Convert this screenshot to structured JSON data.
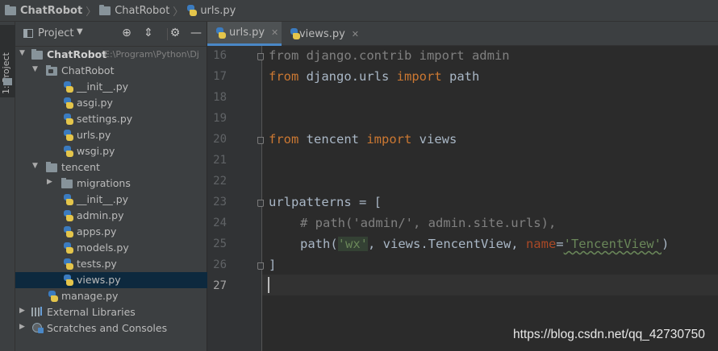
{
  "breadcrumb": {
    "items": [
      "ChatRobot",
      "ChatRobot",
      "urls.py"
    ]
  },
  "left_strip": {
    "label": "1: Project"
  },
  "project_panel": {
    "title": "Project",
    "tree": [
      {
        "label": "ChatRobot",
        "path": "E:\\Program\\Python\\Dj",
        "type": "project"
      },
      {
        "label": "ChatRobot",
        "type": "module"
      },
      {
        "label": "__init__.py",
        "type": "py"
      },
      {
        "label": "asgi.py",
        "type": "py"
      },
      {
        "label": "settings.py",
        "type": "py"
      },
      {
        "label": "urls.py",
        "type": "py"
      },
      {
        "label": "wsgi.py",
        "type": "py"
      },
      {
        "label": "tencent",
        "type": "folder"
      },
      {
        "label": "migrations",
        "type": "folder"
      },
      {
        "label": "__init__.py",
        "type": "py"
      },
      {
        "label": "admin.py",
        "type": "py"
      },
      {
        "label": "apps.py",
        "type": "py"
      },
      {
        "label": "models.py",
        "type": "py"
      },
      {
        "label": "tests.py",
        "type": "py"
      },
      {
        "label": "views.py",
        "type": "py",
        "selected": true
      },
      {
        "label": "manage.py",
        "type": "py"
      },
      {
        "label": "External Libraries",
        "type": "lib"
      },
      {
        "label": "Scratches and Consoles",
        "type": "scratch"
      }
    ]
  },
  "tabs": [
    {
      "label": "urls.py",
      "active": true
    },
    {
      "label": "views.py",
      "active": false
    }
  ],
  "editor": {
    "line_numbers": [
      "16",
      "17",
      "18",
      "19",
      "20",
      "21",
      "22",
      "23",
      "24",
      "25",
      "26",
      "27"
    ],
    "current_line": "27",
    "lines": {
      "l16_kw1": "from",
      "l16_mod": " django.contrib ",
      "l16_kw2": "import",
      "l16_name": " admin",
      "l17_kw1": "from",
      "l17_mod": " django.urls ",
      "l17_kw2": "import",
      "l17_name": " path",
      "l20_kw1": "from",
      "l20_mod": " tencent ",
      "l20_kw2": "import",
      "l20_name": " views",
      "l23": "urlpatterns = [",
      "l24": "# path('admin/', admin.site.urls),",
      "l25_func": "path(",
      "l25_str1": "'wx'",
      "l25_mid": ", views.TencentView, ",
      "l25_kwarg": "name",
      "l25_eq": "=",
      "l25_str2": "'TencentView'",
      "l25_end": ")",
      "l26": "]"
    }
  },
  "watermark": "https://blog.csdn.net/qq_42730750",
  "colors": {
    "background": "#2b2b2b",
    "panel": "#3c3f41",
    "keyword": "#cc7832",
    "string": "#6a8759",
    "comment": "#808080",
    "selection": "#0d293e",
    "tab_accent": "#4a88c7"
  }
}
